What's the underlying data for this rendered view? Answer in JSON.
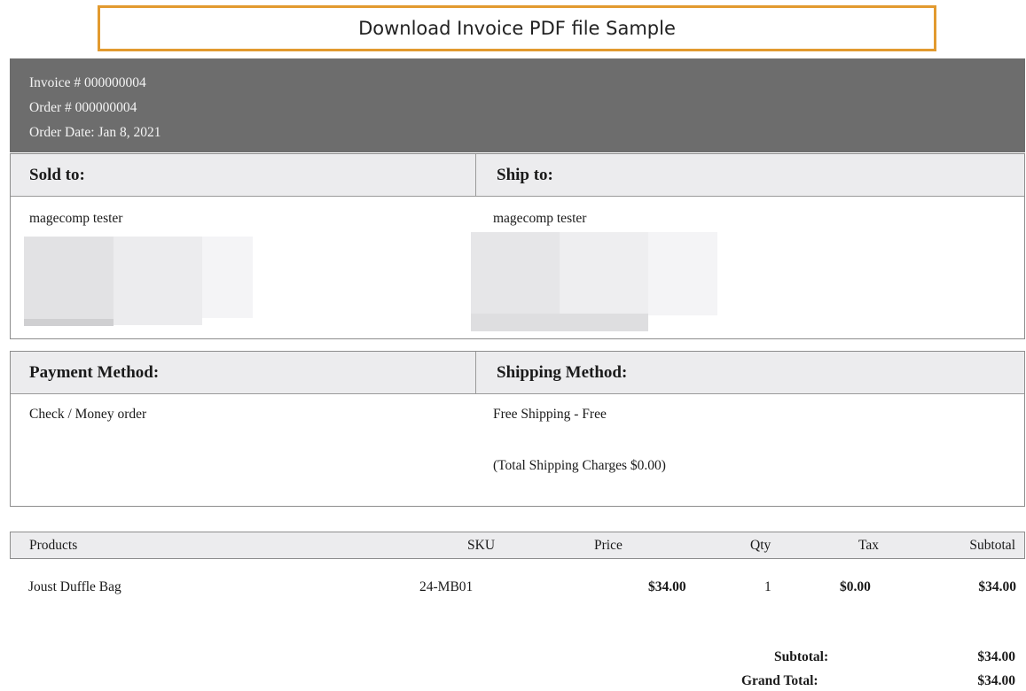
{
  "banner": {
    "title": "Download Invoice PDF file Sample"
  },
  "invoice": {
    "invoice_line": "Invoice # 000000004",
    "order_line": "Order # 000000004",
    "date_line": "Order Date: Jan 8, 2021"
  },
  "addresses": {
    "sold_to_label": "Sold to:",
    "ship_to_label": "Ship to:",
    "sold_to_name": "magecomp tester",
    "ship_to_name": "magecomp tester"
  },
  "methods": {
    "payment_label": "Payment Method:",
    "shipping_label": "Shipping Method:",
    "payment_value": "Check / Money order",
    "shipping_value": "Free Shipping - Free",
    "shipping_charges": "(Total Shipping Charges $0.00)"
  },
  "table": {
    "headers": [
      "Products",
      "SKU",
      "Price",
      "Qty",
      "Tax",
      "Subtotal"
    ],
    "rows": [
      {
        "product": "Joust Duffle Bag",
        "sku": "24-MB01",
        "price": "$34.00",
        "qty": "1",
        "tax": "$0.00",
        "subtotal": "$34.00"
      }
    ]
  },
  "totals": {
    "subtotal_label": "Subtotal:",
    "subtotal_value": "$34.00",
    "grand_total_label": "Grand Total:",
    "grand_total_value": "$34.00"
  },
  "colors": {
    "banner_border": "#e29a2f",
    "header_bg": "#6d6d6d",
    "section_head_bg": "#ececee"
  }
}
